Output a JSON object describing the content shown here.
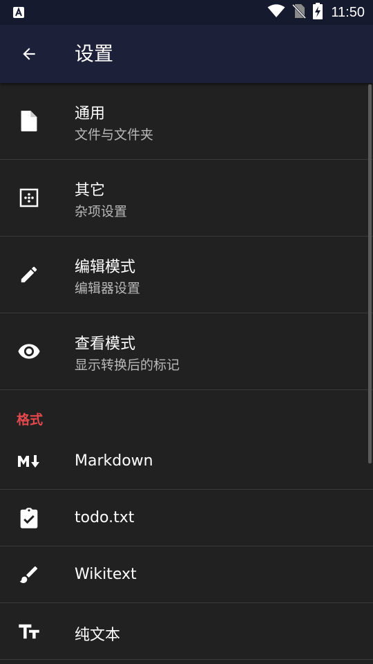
{
  "status": {
    "time": "11:50"
  },
  "app_bar": {
    "title": "设置"
  },
  "items": [
    {
      "title": "通用",
      "subtitle": "文件与文件夹"
    },
    {
      "title": "其它",
      "subtitle": "杂项设置"
    },
    {
      "title": "编辑模式",
      "subtitle": "编辑器设置"
    },
    {
      "title": "查看模式",
      "subtitle": "显示转换后的标记"
    }
  ],
  "format_section": {
    "header": "格式",
    "items": [
      {
        "title": "Markdown"
      },
      {
        "title": "todo.txt"
      },
      {
        "title": "Wikitext"
      },
      {
        "title": "纯文本"
      }
    ]
  },
  "colors": {
    "accent": "#e5484d",
    "background": "#212121",
    "app_bar": "#1c2038",
    "status_bar": "#161a2e"
  }
}
